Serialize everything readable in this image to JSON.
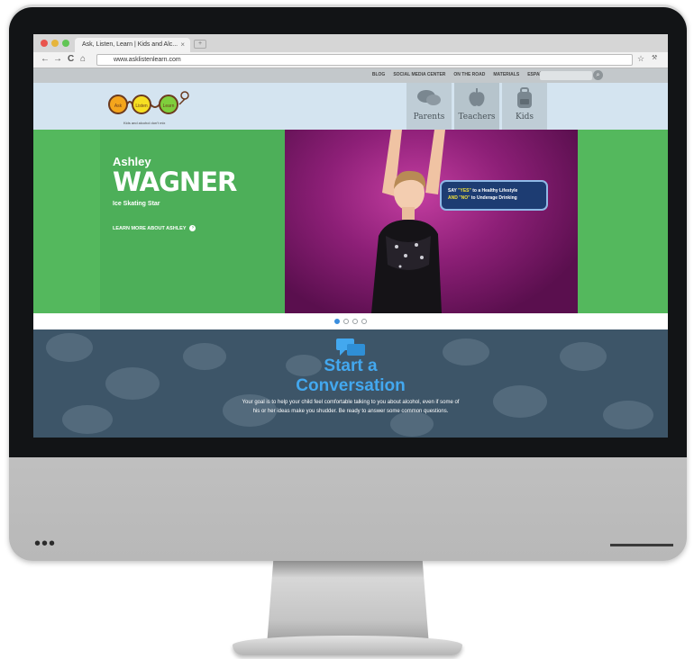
{
  "browser": {
    "tab_title": "Ask, Listen, Learn | Kids and Alc...",
    "tab_close": "×",
    "new_tab": "+",
    "url": "www.asklistenlearn.com",
    "nav_back": "←",
    "nav_forward": "→",
    "reload": "C",
    "home": "⌂",
    "star": "☆",
    "wrench": "🔧"
  },
  "site": {
    "utility_links": [
      "BLOG",
      "SOCIAL MEDIA CENTER",
      "ON THE ROAD",
      "MATERIALS",
      "ESPAÑOL"
    ],
    "logo_words": [
      "Ask",
      "Listen",
      "Learn"
    ],
    "logo_tagline": "Kids and alcohol don't mix",
    "nav_tabs": [
      {
        "label": "Parents",
        "icon": "chat-bubbles-icon"
      },
      {
        "label": "Teachers",
        "icon": "apple-icon"
      },
      {
        "label": "Kids",
        "icon": "backpack-icon"
      }
    ],
    "hero": {
      "first_name": "Ashley",
      "last_name": "WAGNER",
      "role": "Ice Skating Star",
      "link": "LEARN MORE ABOUT ASHLEY",
      "bubble_say": "SAY",
      "bubble_yes": "\"YES\"",
      "bubble_line1_rest": " to a Healthy Lifestyle",
      "bubble_and": "AND",
      "bubble_no": "\"NO\"",
      "bubble_line2_rest": " to Underage Drinking"
    },
    "carousel": {
      "count": 4,
      "active": 0
    },
    "conversation": {
      "title_line1": "Start a",
      "title_line2": "Conversation",
      "text": "Your goal is to help your child feel comfortable talking to you about alcohol, even if some of his or her ideas make you shudder. Be ready to answer some common questions."
    },
    "colors": {
      "accent_blue": "#43a8ef",
      "hero_green": "#4daf59",
      "header_blue": "#d4e4f0"
    }
  },
  "monitor": {
    "chin_dots": "•••"
  }
}
